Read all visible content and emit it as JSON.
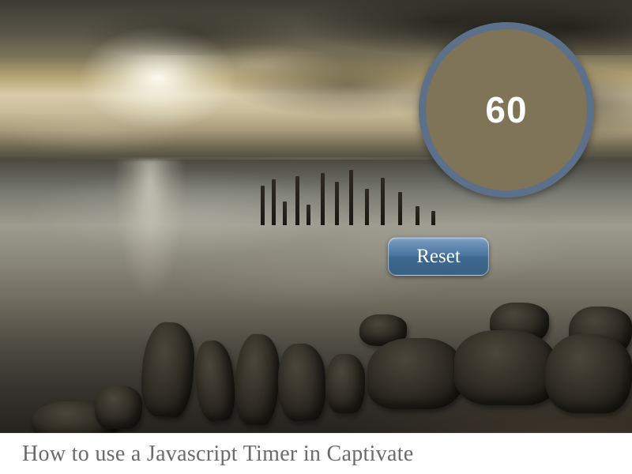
{
  "timer": {
    "value": "60"
  },
  "controls": {
    "reset_label": "Reset"
  },
  "caption": {
    "text": "How to use a Javascript Timer in Captivate"
  },
  "colors": {
    "timer_fill": "#7f7458",
    "timer_border": "#5c7089",
    "button_top": "#8aa8c6",
    "button_bottom": "#3a6186",
    "caption_text": "#6a6a6a"
  }
}
